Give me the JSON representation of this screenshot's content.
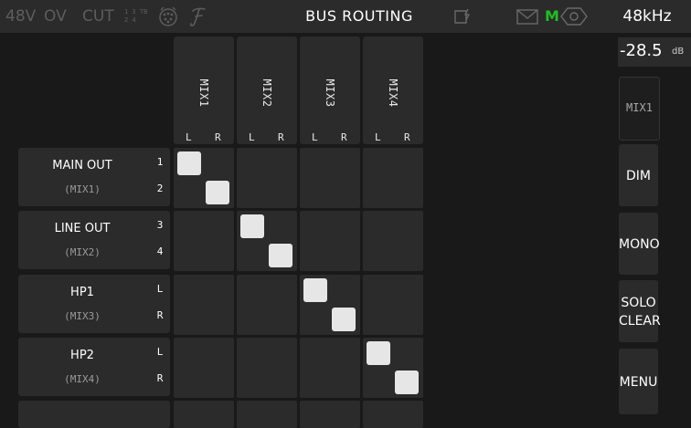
{
  "topbar": {
    "phantom": "48V",
    "offset": "OV",
    "cut": "CUT",
    "cut_top": "1 3 TB",
    "cut_bottom": "2 4",
    "title": "BUS ROUTING",
    "mute": "M",
    "sample_rate": "48kHz",
    "active_color": "#1fbf22",
    "dim_color": "#5d5d5d"
  },
  "columns": [
    {
      "name": "MIX1",
      "left": "L",
      "right": "R"
    },
    {
      "name": "MIX2",
      "left": "L",
      "right": "R"
    },
    {
      "name": "MIX3",
      "left": "L",
      "right": "R"
    },
    {
      "name": "MIX4",
      "left": "L",
      "right": "R"
    }
  ],
  "rows": [
    {
      "name": "MAIN OUT",
      "source": "(MIX1)",
      "ch1": "1",
      "ch2": "2"
    },
    {
      "name": "LINE OUT",
      "source": "(MIX2)",
      "ch1": "3",
      "ch2": "4"
    },
    {
      "name": "HP1",
      "source": "(MIX3)",
      "ch1": "L",
      "ch2": "R"
    },
    {
      "name": "HP2",
      "source": "(MIX4)",
      "ch1": "L",
      "ch2": "R"
    }
  ],
  "sidebar": {
    "level_value": "-28.5",
    "level_unit": "dB",
    "selected_mix": "MIX1",
    "dim": "DIM",
    "mono": "MONO",
    "solo_clear_1": "SOLO",
    "solo_clear_2": "CLEAR",
    "menu": "MENU"
  },
  "routing": [
    {
      "output": "MAIN OUT",
      "mix": "MIX1",
      "left_on": true,
      "right_on": true
    },
    {
      "output": "LINE OUT",
      "mix": "MIX2",
      "left_on": true,
      "right_on": true
    },
    {
      "output": "HP1",
      "mix": "MIX3",
      "left_on": true,
      "right_on": true
    },
    {
      "output": "HP2",
      "mix": "MIX4",
      "left_on": true,
      "right_on": true
    }
  ]
}
